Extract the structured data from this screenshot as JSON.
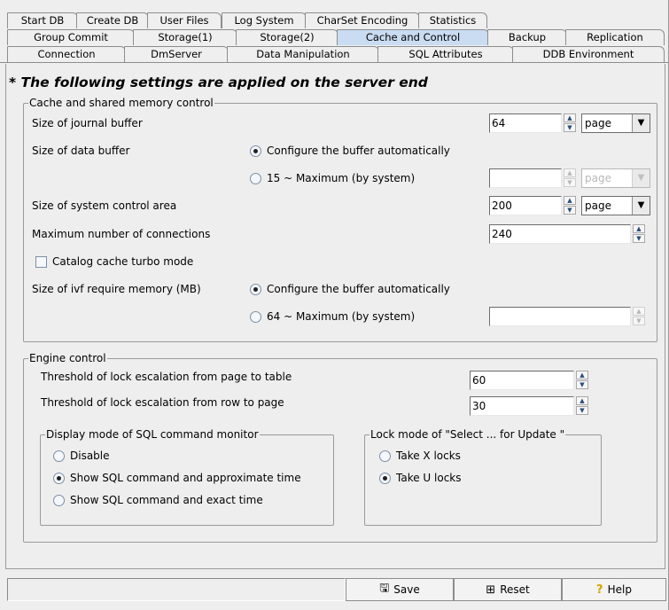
{
  "tabs": {
    "row1": [
      "Start DB",
      "Create DB",
      "User Files",
      "Log System",
      "CharSet Encoding",
      "Statistics"
    ],
    "row2": [
      "Group Commit",
      "Storage(1)",
      "Storage(2)",
      "Cache and Control",
      "Backup",
      "Replication"
    ],
    "row3": [
      "Connection",
      "DmServer",
      "Data Manipulation",
      "SQL Attributes",
      "DDB Environment"
    ],
    "active": "Cache and Control"
  },
  "banner": "* The following settings are applied on the server end",
  "cache": {
    "legend": "Cache and shared memory control",
    "journal_label": "Size of journal buffer",
    "journal_value": "64",
    "journal_unit": "page",
    "data_buffer_label": "Size of data buffer",
    "data_auto_label": "Configure the buffer automatically",
    "data_range_label": "15 ~ Maximum (by system)",
    "data_value": "",
    "data_unit": "page",
    "sys_area_label": "Size of system control area",
    "sys_area_value": "200",
    "sys_area_unit": "page",
    "max_conn_label": "Maximum number of connections",
    "max_conn_value": "240",
    "turbo_label": "Catalog cache turbo mode",
    "ivf_label": "Size of ivf require memory (MB)",
    "ivf_auto_label": "Configure the buffer automatically",
    "ivf_range_label": "64 ~ Maximum (by system)",
    "ivf_value": ""
  },
  "engine": {
    "legend": "Engine control",
    "page_table_label": "Threshold of lock escalation from page to table",
    "page_table_value": "60",
    "row_page_label": "Threshold of lock escalation from row to page",
    "row_page_value": "30",
    "monitor_legend": "Display mode of SQL command monitor",
    "monitor_options": [
      "Disable",
      "Show SQL command and approximate time",
      "Show SQL command and exact time"
    ],
    "lock_legend": "Lock mode of \"Select ... for Update \"",
    "lock_options": [
      "Take X locks",
      "Take U locks"
    ]
  },
  "buttons": {
    "save": "Save",
    "reset": "Reset",
    "help": "Help"
  },
  "colors": {
    "active_tab": "#c9dcf2",
    "panel_bg": "#eeeeee"
  }
}
